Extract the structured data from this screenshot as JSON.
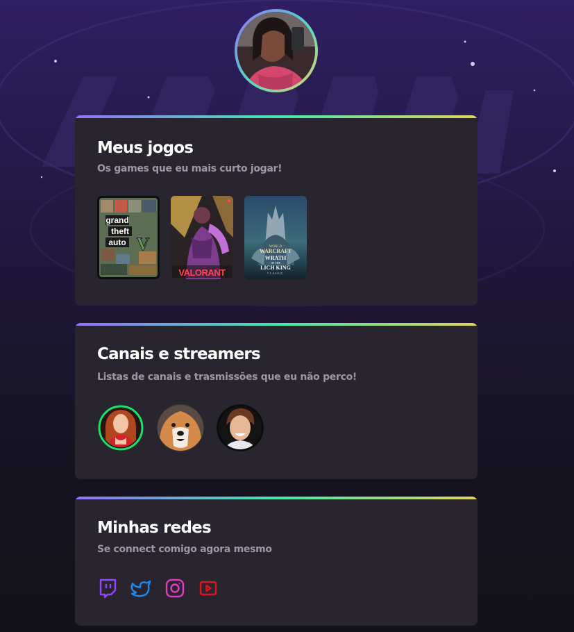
{
  "profile": {
    "avatar_alt": "avatar"
  },
  "games": {
    "title": "Meus jogos",
    "subtitle": "Os games que eu mais curto jogar!",
    "items": [
      {
        "name": "Grand Theft Auto V",
        "line1": "grand",
        "line2": "theft",
        "line3": "auto",
        "mark": "V"
      },
      {
        "name": "Valorant",
        "label": "VALORANT"
      },
      {
        "name": "World of Warcraft: Wrath of the Lich King Classic",
        "top": "WORLD",
        "brand": "WARCRAFT",
        "line1": "WRATH",
        "line2": "OF THE",
        "line3": "LICH KING",
        "line4": "CLASSIC"
      }
    ]
  },
  "streamers": {
    "title": "Canais e streamers",
    "subtitle": "Listas de canais e trasmissões que eu não perco!",
    "items": [
      "streamer-1",
      "streamer-2",
      "streamer-3"
    ]
  },
  "social": {
    "title": "Minhas redes",
    "subtitle": "Se connect comigo agora mesmo",
    "items": [
      {
        "icon": "twitch-icon",
        "color": "#9146ff"
      },
      {
        "icon": "twitter-icon",
        "color": "#1d8cf0"
      },
      {
        "icon": "instagram-icon",
        "color": "#e23cc0"
      },
      {
        "icon": "youtube-icon",
        "color": "#e3121c"
      }
    ]
  }
}
